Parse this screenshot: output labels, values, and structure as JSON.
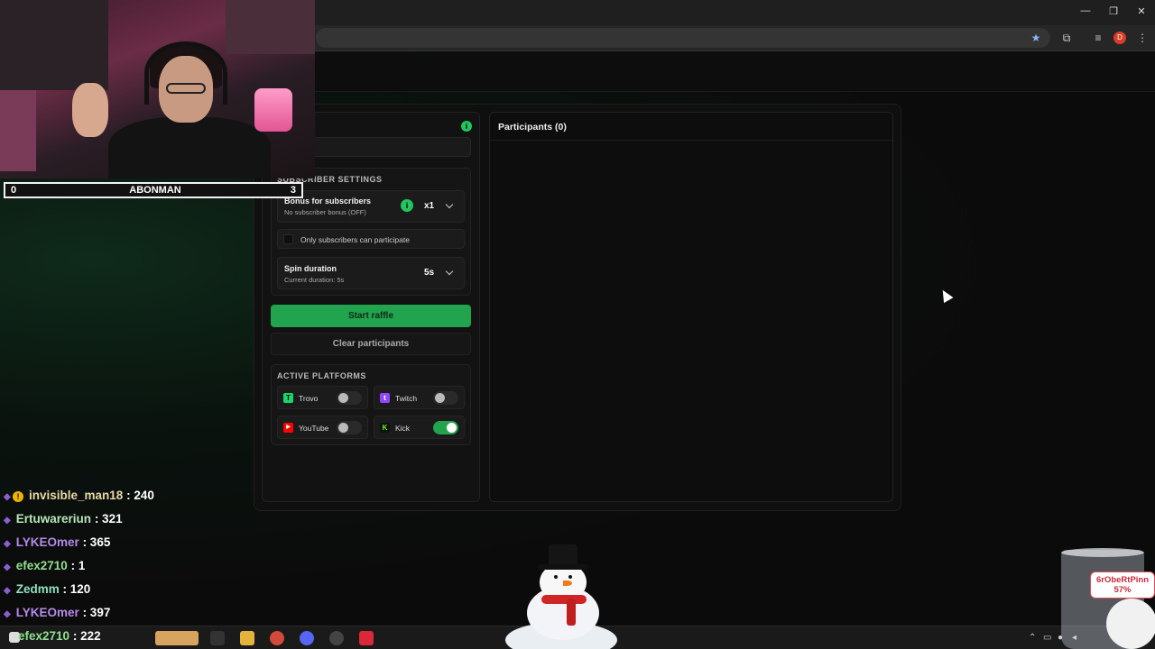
{
  "browser": {
    "window_controls": [
      "—",
      "❐",
      "✕"
    ],
    "profile_initial": "D",
    "icons": [
      "bookmark-star-icon",
      "extensions-icon",
      "media-controls-icon",
      "profile-icon",
      "menu-kebab-icon"
    ]
  },
  "webcam": {
    "scorebar": {
      "left": "0",
      "title": "ABONMAN",
      "right": "3"
    }
  },
  "raffle": {
    "subscriber_settings": {
      "title": "SUBSCRIBER SETTINGS",
      "bonus": {
        "title": "Bonus for subscribers",
        "subtitle": "No subscriber bonus (OFF)",
        "value": "x1",
        "info": "i"
      },
      "subscribers_only": {
        "label": "Only subscribers can participate",
        "checked": false
      },
      "spin": {
        "title": "Spin duration",
        "subtitle": "Current duration: 5s",
        "value": "5s"
      }
    },
    "start_button": "Start raffle",
    "clear_button": "Clear participants",
    "status_info": "i",
    "platforms": {
      "title": "ACTIVE PLATFORMS",
      "items": [
        {
          "name": "Trovo",
          "enabled": false,
          "color": "#19d66b"
        },
        {
          "name": "Twitch",
          "enabled": false,
          "color": "#9146ff"
        },
        {
          "name": "YouTube",
          "enabled": false,
          "color": "#ff0000"
        },
        {
          "name": "Kick",
          "enabled": true,
          "color": "#53fc18"
        }
      ]
    },
    "participants": {
      "title": "Participants (0)"
    }
  },
  "leaderboard": [
    {
      "name": "invisible_man18",
      "score": ": 240",
      "color": "#e8d8a8",
      "badge": "!"
    },
    {
      "name": "Ertuwareriun",
      "score": ": 321",
      "color": "#b8e8b8"
    },
    {
      "name": "LYKEOmer",
      "score": ": 365",
      "color": "#b58ae8"
    },
    {
      "name": "efex2710",
      "score": ": 1",
      "color": "#8fe08f"
    },
    {
      "name": "Zedmm",
      "score": ": 120",
      "color": "#8fe0c0"
    },
    {
      "name": "LYKEOmer",
      "score": ": 397",
      "color": "#b58ae8"
    },
    {
      "name": "efex2710",
      "score": ": 222",
      "color": "#8fe08f"
    }
  ],
  "overlay_tag": {
    "name": "6rObeRtPinn",
    "percent": "57%"
  },
  "colors": {
    "accent_green": "#22a34d",
    "background": "#0c0c0c"
  }
}
